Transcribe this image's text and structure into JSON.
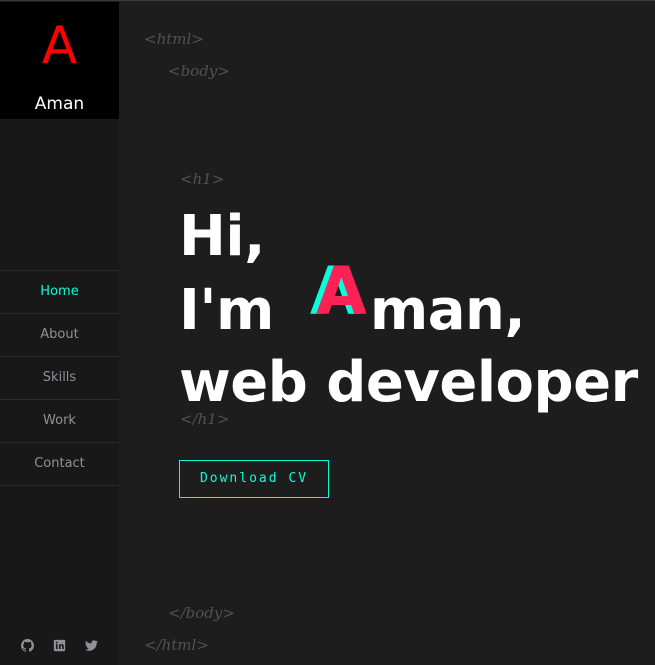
{
  "logo": {
    "letter": "A",
    "name": "Aman"
  },
  "nav": {
    "items": [
      {
        "label": "Home",
        "active": true
      },
      {
        "label": "About"
      },
      {
        "label": "Skills"
      },
      {
        "label": "Work"
      },
      {
        "label": "Contact"
      }
    ]
  },
  "social": {
    "icons": [
      "github-icon",
      "linkedin-icon",
      "twitter-icon"
    ]
  },
  "tags": {
    "html_open": "<html>",
    "body_open": "<body>",
    "h1_open": "<h1>",
    "h1_close": "</h1>",
    "body_close": "</body>",
    "html_close": "</html>"
  },
  "hero": {
    "line1": "Hi,",
    "line2_prefix": "I'm",
    "name_initial": "A",
    "name_rest": "man,",
    "line3": "web developer"
  },
  "cta": {
    "label": "Download CV"
  },
  "colors": {
    "accent": "#08fdd8",
    "accent_red": "#fd2155",
    "logo_red": "#fe0000",
    "background": "#1d1d1d",
    "sidebar": "#181818"
  }
}
